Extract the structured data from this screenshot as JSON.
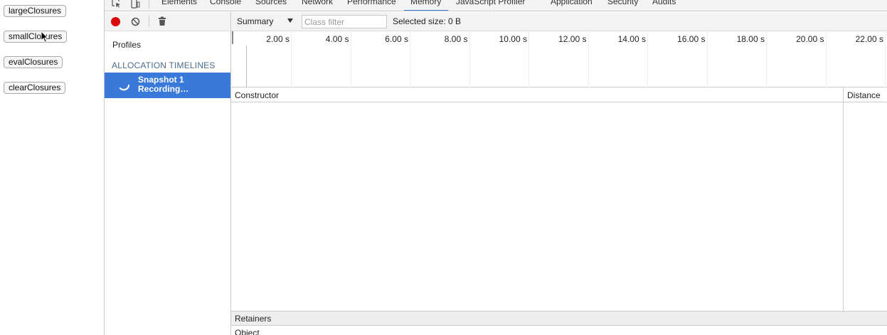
{
  "page": {
    "buttons": [
      "largeClosures",
      "smallClosures",
      "evalClosures",
      "clearClosures"
    ]
  },
  "devtools": {
    "tabs": [
      "Elements",
      "Console",
      "Sources",
      "Network",
      "Performance",
      "Memory",
      "JavaScript Profiler",
      "Application",
      "Security",
      "Audits"
    ],
    "active_tab": "Memory",
    "accent_color": "#3879d9",
    "record_color": "#d80a0a"
  },
  "sidebar": {
    "profiles_label": "Profiles",
    "section_header": "ALLOCATION TIMELINES",
    "snapshot": {
      "title": "Snapshot 1",
      "status": "Recording…"
    }
  },
  "main": {
    "view_selector": "Summary",
    "class_filter_placeholder": "Class filter",
    "selected_size": "Selected size: 0 B",
    "timeline_ticks": [
      "2.00 s",
      "4.00 s",
      "6.00 s",
      "8.00 s",
      "10.00 s",
      "12.00 s",
      "14.00 s",
      "16.00 s",
      "18.00 s",
      "20.00 s",
      "22.00 s"
    ],
    "columns": {
      "constructor": "Constructor",
      "distance": "Distance"
    },
    "retainers_label": "Retainers",
    "object_label": "Object"
  }
}
